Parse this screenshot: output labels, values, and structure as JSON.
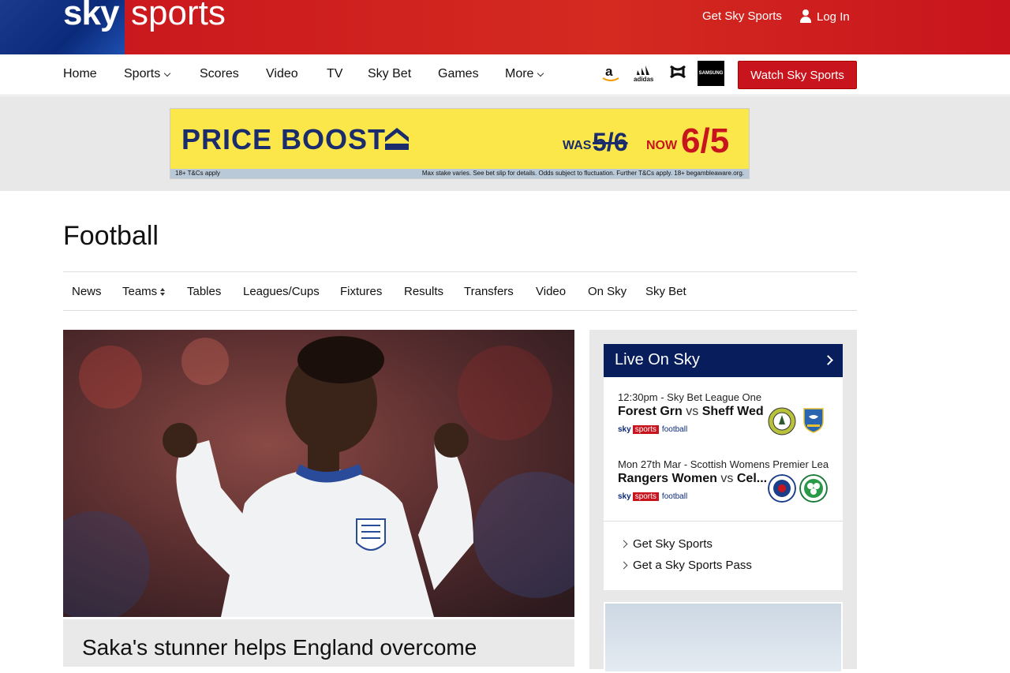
{
  "header": {
    "logo_sky": "sky",
    "logo_sports": "sports",
    "get_sky_sports": "Get Sky Sports",
    "login": "Log In"
  },
  "nav": {
    "items": [
      {
        "label": "Home"
      },
      {
        "label": "Sports"
      },
      {
        "label": "Scores"
      },
      {
        "label": "Video"
      },
      {
        "label": "TV"
      },
      {
        "label": "Sky Bet"
      },
      {
        "label": "Games"
      },
      {
        "label": "More"
      }
    ],
    "sponsors": [
      "amazon",
      "adidas",
      "under-armour",
      "samsung"
    ],
    "sponsor_text": {
      "samsung": "SAMSUNG",
      "adidas": "adidas"
    },
    "watch_button": "Watch Sky Sports"
  },
  "ad": {
    "title": "PRICE BOOST",
    "was_label": "WAS",
    "was_value": "5/6",
    "now_label": "NOW",
    "now_value": "6/5",
    "footer_left": "18+ T&Cs apply",
    "footer_right": "Max stake varies. See bet slip for details. Odds subject to fluctuation. Further T&Cs apply. 18+ begambleaware.org."
  },
  "page": {
    "title": "Football",
    "subnav": [
      "News",
      "Teams",
      "Tables",
      "Leagues/Cups",
      "Fixtures",
      "Results",
      "Transfers",
      "Video",
      "On Sky",
      "Sky Bet"
    ]
  },
  "hero": {
    "headline": "Saka's stunner helps England overcome"
  },
  "sidebar": {
    "live_title": "Live On Sky",
    "matches": [
      {
        "meta": "12:30pm - Sky Bet League One",
        "home": "Forest Grn",
        "vs": "vs",
        "away": "Sheff Wed",
        "channel_sky": "sky",
        "channel_sports": "sports",
        "channel_name": "football"
      },
      {
        "meta": "Mon 27th Mar - Scottish Womens Premier Lea",
        "home": "Rangers Women",
        "vs": "vs",
        "away": "Cel...",
        "channel_sky": "sky",
        "channel_sports": "sports",
        "channel_name": "football"
      }
    ],
    "links": [
      "Get Sky Sports",
      "Get a Sky Sports Pass"
    ]
  },
  "colors": {
    "brand_red": "#c8141d",
    "brand_blue": "#071d5c",
    "ad_yellow": "#fbe74a"
  }
}
